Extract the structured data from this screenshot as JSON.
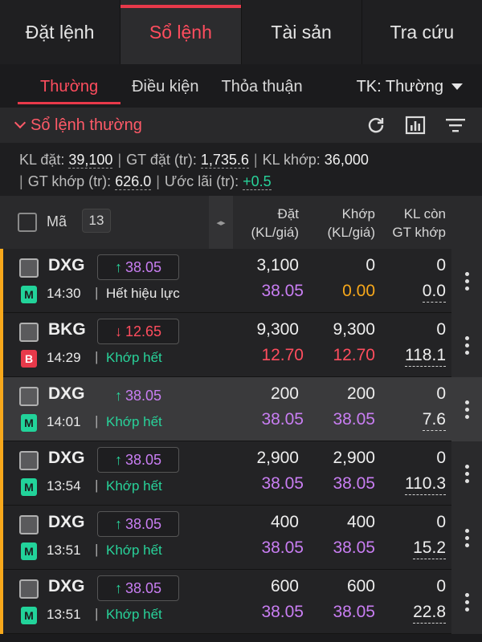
{
  "top_tabs": [
    {
      "label": "Đặt lệnh",
      "active": false
    },
    {
      "label": "Sổ lệnh",
      "active": true
    },
    {
      "label": "Tài sản",
      "active": false
    },
    {
      "label": "Tra cứu",
      "active": false
    }
  ],
  "sub_tabs": [
    {
      "label": "Thường",
      "active": true
    },
    {
      "label": "Điều kiện",
      "active": false
    },
    {
      "label": "Thỏa thuận",
      "active": false
    }
  ],
  "account_select": "TK: Thường",
  "section_title": "Sổ lệnh thường",
  "icons": {
    "refresh": "refresh-icon",
    "chart": "bar-chart-icon",
    "filter": "filter-icon"
  },
  "summary": {
    "kl_dat_label": "KL đặt:",
    "kl_dat": "39,100",
    "gt_dat_label": "GT đặt (tr):",
    "gt_dat": "1,735.6",
    "kl_khop_label": "KL khớp:",
    "kl_khop": "36,000",
    "gt_khop_label": "GT khớp (tr):",
    "gt_khop": "626.0",
    "uoc_lai_label": "Ước lãi (tr):",
    "uoc_lai": "+0.5"
  },
  "table_header": {
    "ma": "Mã",
    "count": "13",
    "dat_line1": "Đặt",
    "dat_line2": "(KL/giá)",
    "khop_line1": "Khớp",
    "khop_line2": "(KL/giá)",
    "con_line1": "KL còn",
    "con_line2": "GT khớp"
  },
  "colors": {
    "accent": "#e8394a",
    "up": "#28d39a",
    "price_ref": "#c97ef3",
    "side_bar": "#f7a81b"
  },
  "orders": [
    {
      "symbol": "DXG",
      "direction": "up",
      "arrow": "↑",
      "ref_price": "38.05",
      "side": "M",
      "side_type": "buy",
      "time": "14:30",
      "status": "Hết hiệu lực",
      "status_type": "expired",
      "dat_kl": "3,100",
      "dat_gia": "38.05",
      "dat_gia_color": "purple",
      "khop_kl": "0",
      "khop_gia": "0.00",
      "khop_gia_color": "orange",
      "kl_con": "0",
      "gt_khop": "0.0",
      "highlight": false
    },
    {
      "symbol": "BKG",
      "direction": "down",
      "arrow": "↓",
      "ref_price": "12.65",
      "side": "B",
      "side_type": "sell",
      "time": "14:29",
      "status": "Khớp hết",
      "status_type": "matched",
      "dat_kl": "9,300",
      "dat_gia": "12.70",
      "dat_gia_color": "red",
      "khop_kl": "9,300",
      "khop_gia": "12.70",
      "khop_gia_color": "red",
      "kl_con": "0",
      "gt_khop": "118.1",
      "highlight": false
    },
    {
      "symbol": "DXG",
      "direction": "up",
      "arrow": "↑",
      "ref_price": "38.05",
      "side": "M",
      "side_type": "buy",
      "time": "14:01",
      "status": "Khớp hết",
      "status_type": "matched",
      "dat_kl": "200",
      "dat_gia": "38.05",
      "dat_gia_color": "purple",
      "khop_kl": "200",
      "khop_gia": "38.05",
      "khop_gia_color": "purple",
      "kl_con": "0",
      "gt_khop": "7.6",
      "highlight": true
    },
    {
      "symbol": "DXG",
      "direction": "up",
      "arrow": "↑",
      "ref_price": "38.05",
      "side": "M",
      "side_type": "buy",
      "time": "13:54",
      "status": "Khớp hết",
      "status_type": "matched",
      "dat_kl": "2,900",
      "dat_gia": "38.05",
      "dat_gia_color": "purple",
      "khop_kl": "2,900",
      "khop_gia": "38.05",
      "khop_gia_color": "purple",
      "kl_con": "0",
      "gt_khop": "110.3",
      "highlight": false
    },
    {
      "symbol": "DXG",
      "direction": "up",
      "arrow": "↑",
      "ref_price": "38.05",
      "side": "M",
      "side_type": "buy",
      "time": "13:51",
      "status": "Khớp hết",
      "status_type": "matched",
      "dat_kl": "400",
      "dat_gia": "38.05",
      "dat_gia_color": "purple",
      "khop_kl": "400",
      "khop_gia": "38.05",
      "khop_gia_color": "purple",
      "kl_con": "0",
      "gt_khop": "15.2",
      "highlight": false
    },
    {
      "symbol": "DXG",
      "direction": "up",
      "arrow": "↑",
      "ref_price": "38.05",
      "side": "M",
      "side_type": "buy",
      "time": "13:51",
      "status": "Khớp hết",
      "status_type": "matched",
      "dat_kl": "600",
      "dat_gia": "38.05",
      "dat_gia_color": "purple",
      "khop_kl": "600",
      "khop_gia": "38.05",
      "khop_gia_color": "purple",
      "kl_con": "0",
      "gt_khop": "22.8",
      "highlight": false
    }
  ]
}
